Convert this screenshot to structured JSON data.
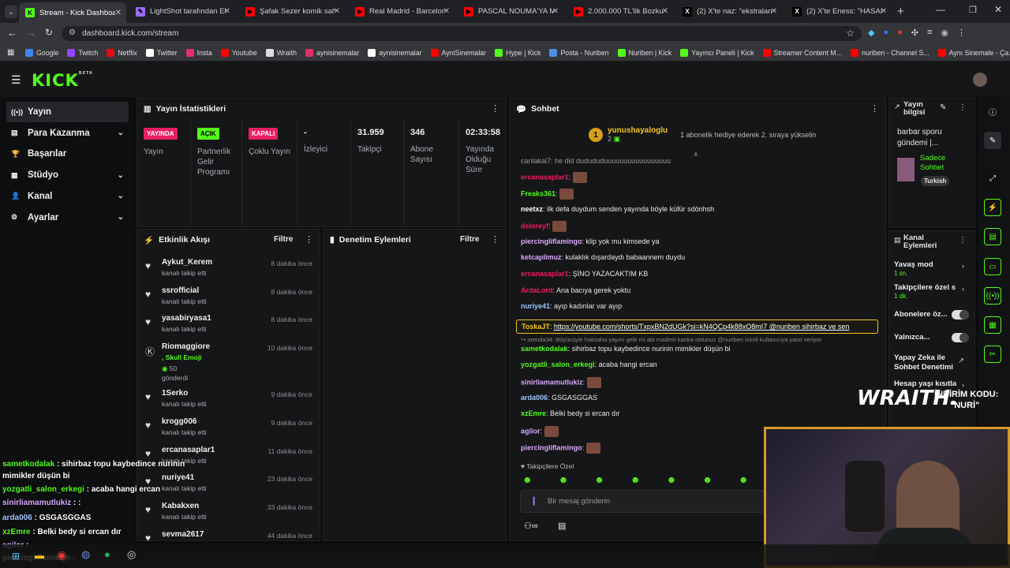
{
  "tabs": [
    {
      "title": "Stream - Kick Dashboard",
      "color": "#53fc18",
      "glyph": "K"
    },
    {
      "title": "LightShot tarafından Ekra",
      "color": "#9a6cff",
      "glyph": "✎"
    },
    {
      "title": "Şafak Sezer komik sah",
      "color": "#ff0000",
      "glyph": "▶"
    },
    {
      "title": "Real Madrid - Barcelona",
      "color": "#ff0000",
      "glyph": "▶"
    },
    {
      "title": "PASCAL NOUMA'YA MEY",
      "color": "#ff0000",
      "glyph": "▶"
    },
    {
      "title": "2.000.000 TL'lik Bozkurt",
      "color": "#ff0000",
      "glyph": "▶"
    },
    {
      "title": "(2) X'te naz: \"ekstralarıyla",
      "color": "#ffffff",
      "glyph": "X"
    },
    {
      "title": "(2) X'te Eness: \"HASAN Y",
      "color": "#ffffff",
      "glyph": "X"
    }
  ],
  "address": {
    "url": "dashboard.kick.com/stream"
  },
  "bookmarks": [
    {
      "label": "Google",
      "color": "#4285f4"
    },
    {
      "label": "Twitch",
      "color": "#9146ff"
    },
    {
      "label": "Netflix",
      "color": "#e50914"
    },
    {
      "label": "Twitter",
      "color": "#ffffff"
    },
    {
      "label": "Insta",
      "color": "#e1306c"
    },
    {
      "label": "Youtube",
      "color": "#ff0000"
    },
    {
      "label": "Wraith",
      "color": "#dddddd"
    },
    {
      "label": "aynisinemalar",
      "color": "#e1306c"
    },
    {
      "label": "aynisinemalar",
      "color": "#ffffff"
    },
    {
      "label": "AyniSinemalar",
      "color": "#ff0000"
    },
    {
      "label": "Hype | Kick",
      "color": "#53fc18"
    },
    {
      "label": "Posta - Nuriben",
      "color": "#4a90e2"
    },
    {
      "label": "Nuriben | Kick",
      "color": "#53fc18"
    },
    {
      "label": "Yayıncı Paneli | Kick",
      "color": "#53fc18"
    },
    {
      "label": "Streamer Content M...",
      "color": "#ff0000"
    },
    {
      "label": "nuriben - Channel S...",
      "color": "#ff0000"
    },
    {
      "label": "Aynı Sinemale - Ça...",
      "color": "#ff0000"
    }
  ],
  "logo": "KICK",
  "logo_beta": "BETA",
  "sidebar": [
    {
      "label": "Yayın",
      "icon": "((•))"
    },
    {
      "label": "Para Kazanma",
      "icon": "▤"
    },
    {
      "label": "Başarılar",
      "icon": "🏆"
    },
    {
      "label": "Stüdyo",
      "icon": "▦"
    },
    {
      "label": "Kanal",
      "icon": "👤"
    },
    {
      "label": "Ayarlar",
      "icon": "⚙"
    }
  ],
  "stats": {
    "title": "Yayın İstatistikleri",
    "items": [
      {
        "badge": "YAYINDA",
        "badge_bg": "#e91e63",
        "label": "Yayın"
      },
      {
        "badge": "AÇIK",
        "badge_bg": "#53fc18",
        "label": "Partnerlik Gelir Programı"
      },
      {
        "badge": "KAPALI",
        "badge_bg": "#e91e63",
        "label": "Çoklu Yayın"
      },
      {
        "value": "-",
        "label": "İzleyici"
      },
      {
        "value": "31.959",
        "label": "Takipçi"
      },
      {
        "value": "346",
        "label": "Abone Sayısı"
      },
      {
        "value": "02:33:58",
        "label": "Yayında Olduğu Süre"
      }
    ]
  },
  "activity": {
    "title": "Etkinlik Akışı",
    "filter": "Filtre",
    "items": [
      {
        "name": "Aykut_Kerem",
        "sub": "kanalı takip etti",
        "time": "8 dakika önce"
      },
      {
        "name": "ssrofficial",
        "sub": "kanalı takip etti",
        "time": "8 dakika önce"
      },
      {
        "name": "yasabiryasa1",
        "sub": "kanalı takip etti",
        "time": "8 dakika önce"
      },
      {
        "name": "Riomaggiore",
        "sub": ", Skull Emoji",
        "extra": "50",
        "extra2": "gönderdi",
        "time": "10 dakika önce"
      },
      {
        "name": "1Serko",
        "sub": "kanalı takip etti",
        "time": "9 dakika önce"
      },
      {
        "name": "krogg006",
        "sub": "kanalı takip etti",
        "time": "9 dakika önce"
      },
      {
        "name": "ercanasaplar1",
        "sub": "kanalı takip etti",
        "time": "11 dakika önce"
      },
      {
        "name": "nuriye41",
        "sub": "kanalı takip etti",
        "time": "23 dakika önce"
      },
      {
        "name": "Kabakxen",
        "sub": "kanalı takip etti",
        "time": "33 dakika önce"
      },
      {
        "name": "sevma2617",
        "sub": "",
        "time": "44 dakika önce"
      }
    ]
  },
  "moderation": {
    "title": "Denetim Eylemleri",
    "filter": "Filtre"
  },
  "chat": {
    "title": "Sohbet",
    "pinned_user": "yunushayaloglu",
    "pinned_num": "2",
    "pinned_text": "1 abonelik hediye ederek 2. sıraya yükselin",
    "cut_top": "canlakal7: he did dudududuuuuuuuuuuuuuuuuu",
    "messages": [
      {
        "user": "ercanasaplar1",
        "color": "#e91e63",
        "text": "",
        "emote": true
      },
      {
        "user": "Freaks361",
        "color": "#53fc18",
        "text": "",
        "emote": true
      },
      {
        "user": "neetxz",
        "color": "#ffffff",
        "text": "ilk defa duydum senden yayında böyle küfür sdönhsh"
      },
      {
        "user": "deloreyf",
        "color": "#e91e63",
        "text": "",
        "emote": true
      },
      {
        "user": "piercingliflamingo",
        "color": "#d9a9ff",
        "text": "klip yok mu kimsede ya"
      },
      {
        "user": "ketcaplimuz",
        "color": "#d9a9ff",
        "text": "kulaklık dışardaydı babaannem duydu"
      },
      {
        "user": "ercanasaplar1",
        "color": "#e91e63",
        "text": "ŞİNO YAZACAKTIM KB"
      },
      {
        "user": "ArdaLord",
        "color": "#e91e63",
        "text": "Ana bacıya gerek yoktu"
      },
      {
        "user": "nuriye41",
        "color": "#9ec5ff",
        "text": "ayıp kadınlar var ayıp"
      },
      {
        "user": "ToskaJT",
        "color": "#f5c518",
        "text": "https://youtube.com/shorts/TxpxBN2dUGk?si=kN4QCp4k88xO8mI7 @nuriben sihirbaz ve sen"
      },
      {
        "user": "",
        "color": "#8a8e94",
        "text": "↪ orenda34: Büyücüyle halısaha yayını gelir mi abi madem kanka oldunuz @nuriben isimli kullanıcıya yanıt veriyor"
      },
      {
        "user": "sametkodalak",
        "color": "#53fc18",
        "text": "sihirbaz topu kaybedince nurinin mimikler düşün bi"
      },
      {
        "user": "yozgatli_salon_erkegi",
        "color": "#53fc18",
        "text": "acaba hangi ercan"
      },
      {
        "user": "sinirliamamutlukiz",
        "color": "#d9a9ff",
        "text": "",
        "emote": true
      },
      {
        "user": "arda006",
        "color": "#9ec5ff",
        "text": "GSGASGGAS"
      },
      {
        "user": "xzEmre",
        "color": "#53fc18",
        "text": "Belki bedy si ercan dır"
      },
      {
        "user": "agilor",
        "color": "#d9a9ff",
        "text": "",
        "emote": true
      },
      {
        "user": "piercingliflamingo",
        "color": "#d9a9ff",
        "text": "",
        "emote": true
      }
    ],
    "followers_only": "Takipçilere Özel",
    "input_placeholder": "Bir mesaj gönderin"
  },
  "stream_info": {
    "title": "Yayın bilgisi",
    "stream_title": "barbar sporu gündemi |...",
    "lang": "Turkish",
    "mode": "Sadece Sohbet"
  },
  "channel_actions": {
    "title": "Kanal Eylemleri",
    "items": [
      {
        "label": "Yavaş mod",
        "sub": "1 sn."
      },
      {
        "label": "Takipçilere özel s",
        "sub": "1 dk."
      },
      {
        "label": "Abonelere öz..."
      },
      {
        "label": "Yalnızca..."
      },
      {
        "label": "Yapay Zeka ile Sohbet Denetimi"
      },
      {
        "label": "Hesap yaşı kısıtla"
      }
    ]
  },
  "overlay": {
    "brand": "WRAITH.",
    "promo1": "İNDİRİM KODU:",
    "promo2": "\"NURİ\"",
    "chat": [
      {
        "user": "sametkodalak",
        "text": "sihirbaz topu kaybedince nurinin",
        "color": "#53fc18"
      },
      {
        "user": "",
        "text": "mimikler düşün bi",
        "color": "#ffffff"
      },
      {
        "user": "yozgatli_salon_erkegi",
        "text": "acaba hangi ercan",
        "color": "#53fc18"
      },
      {
        "user": "sinirliamamutlukiz",
        "text": ":",
        "color": "#d9a9ff"
      },
      {
        "user": "arda006",
        "text": "GSGASGGAS",
        "color": "#9ec5ff"
      },
      {
        "user": "xzEmre",
        "text": "Belki bedy si ercan dır",
        "color": "#53fc18"
      },
      {
        "user": "agilor",
        "text": "",
        "color": "#d9a9ff"
      },
      {
        "user": "piercingliflamingo",
        "text": "",
        "color": "#ffffff"
      }
    ]
  }
}
